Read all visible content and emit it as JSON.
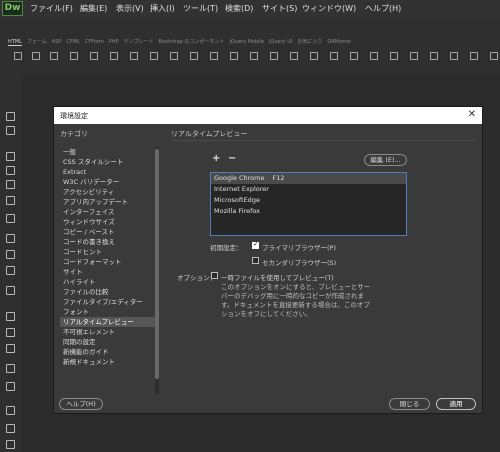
{
  "app": {
    "logo": "Dw"
  },
  "menubar": [
    "ファイル(F)",
    "編集(E)",
    "表示(V)",
    "挿入(I)",
    "ツール(T)",
    "検索(D)",
    "サイト(S)",
    "ウィンドウ(W)",
    "ヘルプ(H)"
  ],
  "insert_tabs": [
    "HTML",
    "フォーム",
    "ASP",
    "CFML",
    "CFForm",
    "PHP",
    "テンプレート",
    "Bootstrap のコンポーネント",
    "jQuery Mobile",
    "jQuery UI",
    "お気に入り",
    "OAMzone"
  ],
  "dialog": {
    "title": "環境設定",
    "close_glyph": "✕",
    "category_label": "カテゴリ",
    "categories": [
      "一般",
      "CSS スタイルシート",
      "Extract",
      "W3C バリデーター",
      "アクセシビリティ",
      "アプリ内アップデート",
      "インターフェイス",
      "ウィンドウサイズ",
      "コピー / ペースト",
      "コードの書き換え",
      "コードヒント",
      "コードフォーマット",
      "サイト",
      "ハイライト",
      "ファイルの比較",
      "ファイルタイプ/エディター",
      "フォント",
      "リアルタイムプレビュー",
      "不可視エレメント",
      "同期の設定",
      "新機能のガイド",
      "新規ドキュメント"
    ],
    "selected_category": "リアルタイムプレビュー",
    "section_title": "リアルタイムプレビュー",
    "add_glyph": "+",
    "remove_glyph": "−",
    "edit_button": "編集 (E)...",
    "browsers": [
      {
        "name": "Google Chrome",
        "key": "F12"
      },
      {
        "name": "Internet Explorer",
        "key": ""
      },
      {
        "name": "MicrosoftEdge",
        "key": ""
      },
      {
        "name": "Mozilla Firefox",
        "key": ""
      }
    ],
    "defaults_label": "初期設定：",
    "primary_browser_label": "プライマリブラウザー(P)",
    "primary_checked": true,
    "secondary_browser_label": "セカンダリブラウザー(S)",
    "secondary_checked": false,
    "options_label": "オプション：",
    "temp_file_label": "一時ファイルを使用してプレビュー(T)",
    "temp_file_checked": false,
    "note": "このオプションをオンにすると、プレビューとサーバーのデバッグ用に一時的なコピーが作成されます。ドキュメントを直接更新する場合は、このオプションをオフにしてください。",
    "help_button": "ヘルプ(H)",
    "close_button": "閉じる",
    "apply_button": "適用"
  }
}
